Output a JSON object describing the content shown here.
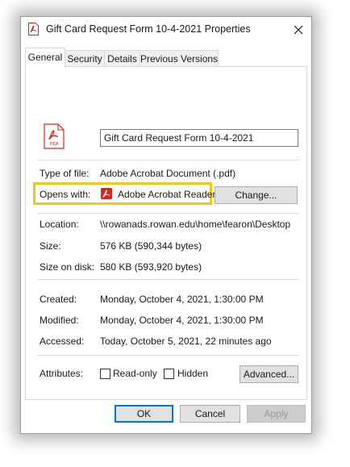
{
  "window": {
    "title": "Gift Card Request Form 10-4-2021 Properties",
    "icon": "pdf-file-icon",
    "close_icon": "close-icon"
  },
  "tabs": [
    {
      "label": "General",
      "active": true
    },
    {
      "label": "Security",
      "active": false
    },
    {
      "label": "Details",
      "active": false
    },
    {
      "label": "Previous Versions",
      "active": false
    }
  ],
  "general": {
    "file_name": "Gift Card Request Form 10-4-2021",
    "file_icon": "pdf-file-icon",
    "file_icon_text": "PDF",
    "type_label": "Type of file:",
    "type_value": "Adobe Acrobat Document (.pdf)",
    "opens_label": "Opens with:",
    "opens_value": "Adobe Acrobat Reader",
    "opens_icon": "acrobat-icon",
    "change_button": "Change...",
    "location_label": "Location:",
    "location_value": "\\\\rowanads.rowan.edu\\home\\fearon\\Desktop",
    "size_label": "Size:",
    "size_value": "576 KB (590,344 bytes)",
    "size_disk_label": "Size on disk:",
    "size_disk_value": "580 KB (593,920 bytes)",
    "created_label": "Created:",
    "created_value": "Monday, October 4, 2021, 1:30:00 PM",
    "modified_label": "Modified:",
    "modified_value": "Monday, October 4, 2021, 1:30:00 PM",
    "accessed_label": "Accessed:",
    "accessed_value": "Today, October 5, 2021, 22 minutes ago",
    "attributes_label": "Attributes:",
    "readonly_label": "Read-only",
    "readonly_checked": false,
    "hidden_label": "Hidden",
    "hidden_checked": false,
    "advanced_button": "Advanced..."
  },
  "footer": {
    "ok": "OK",
    "cancel": "Cancel",
    "apply": "Apply"
  },
  "colors": {
    "highlight": "#f5c518",
    "pdf_red": "#d9261c",
    "default_button_border": "#0078d7"
  }
}
